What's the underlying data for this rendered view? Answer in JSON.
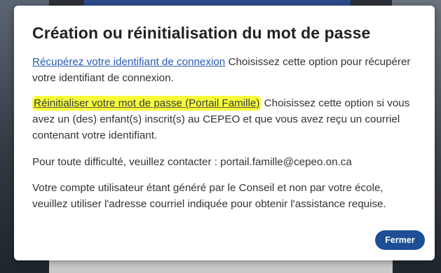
{
  "modal": {
    "title": "Création ou réinitialisation du mot de passe",
    "recover": {
      "link_label": "Récupérez votre identifiant de connexion",
      "description": " Choisissez cette option pour récupérer votre identifiant de connexion."
    },
    "reset": {
      "link_label": "Réinitialiser votre mot de passe (Portail Famille)",
      "description": " Choisissez cette option si vous avez un (des) enfant(s) inscrit(s) au CEPEO et que vous avez reçu un courriel contenant votre identifiant."
    },
    "contact_text": "Pour toute difficulté, veuillez contacter : portail.famille@cepeo.on.ca",
    "account_text": "Votre compte utilisateur étant généré par le Conseil et non par votre école, veuillez utiliser l'adresse courriel indiquée pour obtenir l'assistance requise.",
    "close_label": "Fermer"
  },
  "colors": {
    "link": "#2a5db0",
    "highlight": "#f7ff3a",
    "button": "#1e4f96"
  }
}
